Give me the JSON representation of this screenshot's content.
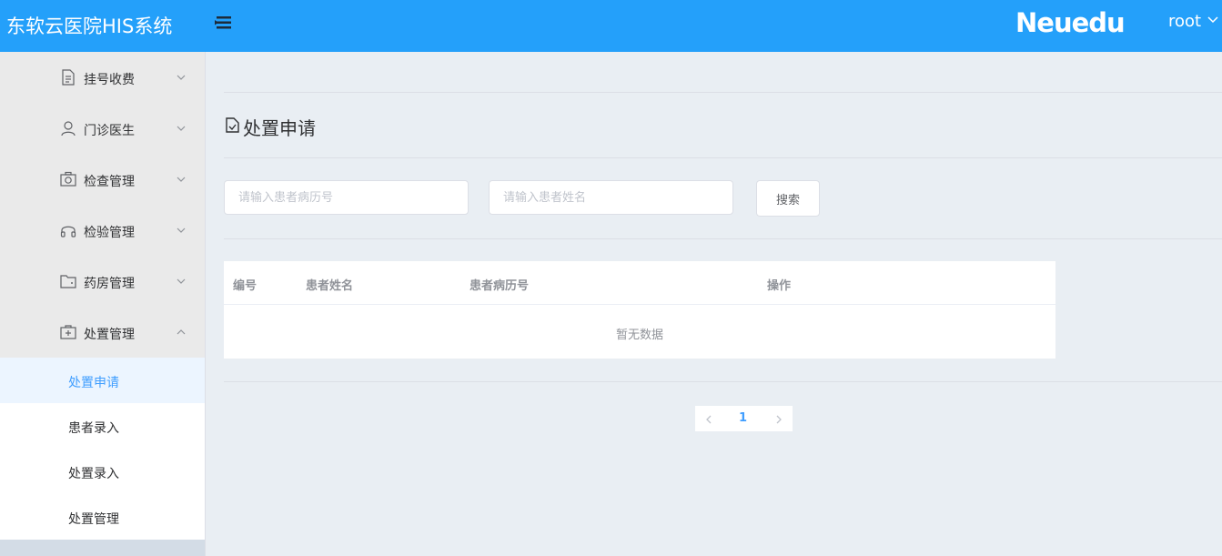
{
  "header": {
    "app_title": "东软云医院HIS系统",
    "brand": "Neuedu",
    "user": "root"
  },
  "sidebar": {
    "groups": [
      {
        "label": "挂号收费",
        "icon": "document-icon",
        "expanded": false
      },
      {
        "label": "门诊医生",
        "icon": "user-icon",
        "expanded": false
      },
      {
        "label": "检查管理",
        "icon": "camera-icon",
        "expanded": false
      },
      {
        "label": "检验管理",
        "icon": "headset-icon",
        "expanded": false
      },
      {
        "label": "药房管理",
        "icon": "wallet-icon",
        "expanded": false
      },
      {
        "label": "处置管理",
        "icon": "first-aid-icon",
        "expanded": true
      }
    ],
    "sub_items": [
      {
        "label": "处置申请",
        "active": true
      },
      {
        "label": "患者录入",
        "active": false
      },
      {
        "label": "处置录入",
        "active": false
      },
      {
        "label": "处置管理",
        "active": false
      }
    ]
  },
  "main": {
    "page_title": "处置申请",
    "search": {
      "record_placeholder": "请输入患者病历号",
      "name_placeholder": "请输入患者姓名",
      "button_label": "搜索"
    },
    "table": {
      "columns": [
        "编号",
        "患者姓名",
        "患者病历号",
        "操作"
      ],
      "rows": [],
      "empty_text": "暂无数据"
    },
    "pagination": {
      "current_page": "1"
    }
  },
  "colors": {
    "header_bg": "#24a0fa",
    "accent": "#409eff",
    "page_bg": "#e9eef3",
    "sidebar_bg": "#eaeaea"
  }
}
